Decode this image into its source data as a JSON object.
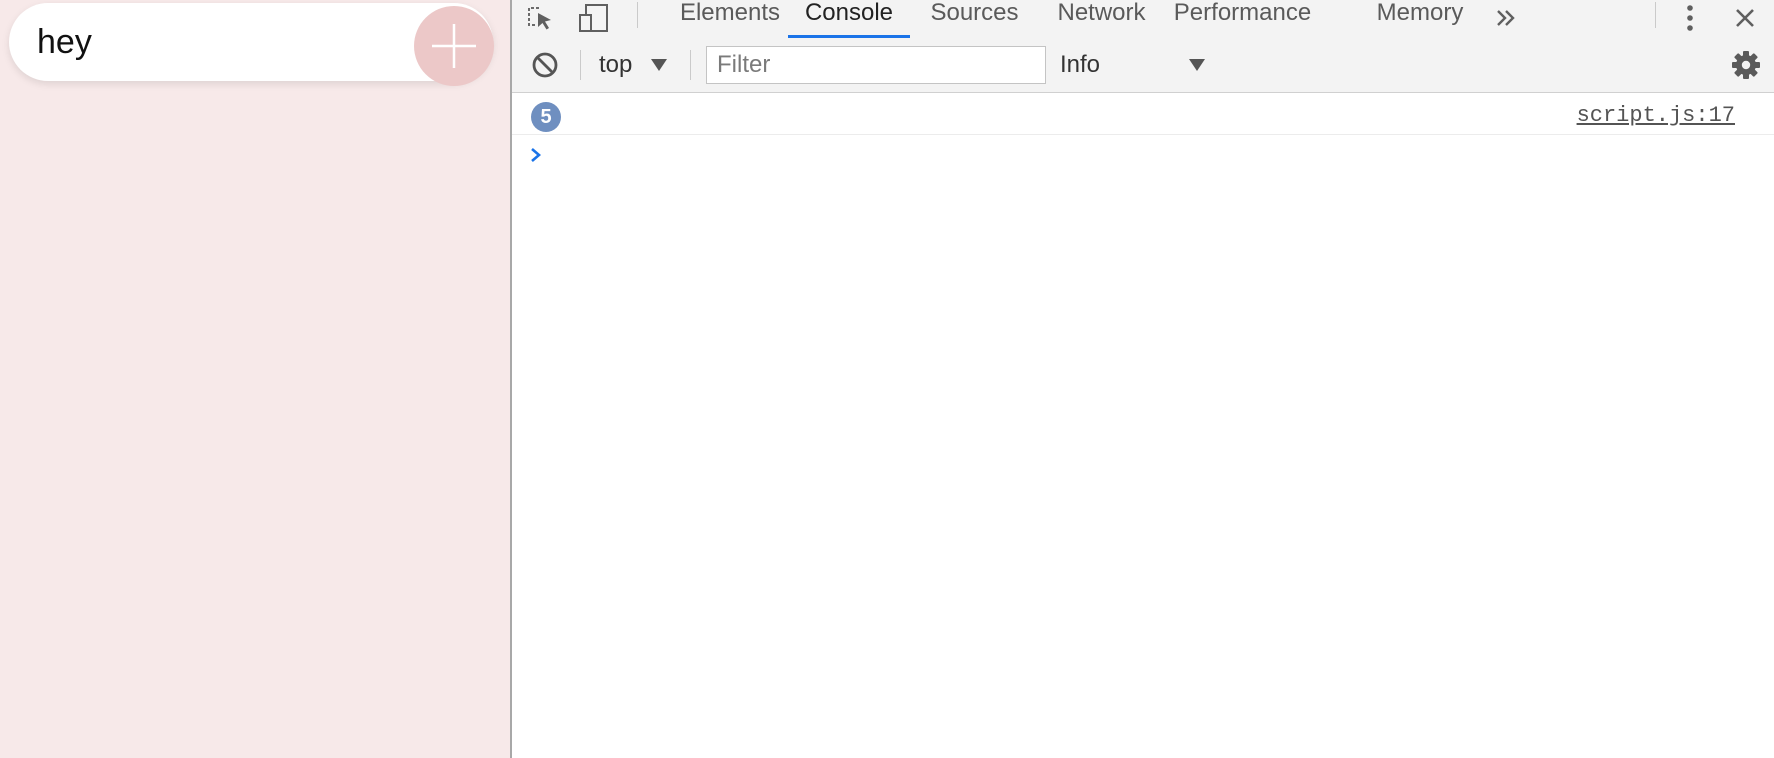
{
  "page": {
    "todo_input_value": "hey",
    "add_button_icon": "plus-icon",
    "background_color": "#f7e9e9",
    "add_button_color": "#ecc8c8"
  },
  "devtools": {
    "toolbar_icons": [
      "inspect-element-icon",
      "device-toolbar-icon",
      "more-tabs-icon",
      "more-options-icon",
      "close-icon"
    ],
    "tabs": [
      {
        "label": "Elements",
        "active": false
      },
      {
        "label": "Console",
        "active": true
      },
      {
        "label": "Sources",
        "active": false
      },
      {
        "label": "Network",
        "active": false
      },
      {
        "label": "Performance",
        "active": false
      },
      {
        "label": "Memory",
        "active": false
      }
    ],
    "console_toolbar": {
      "clear_icon": "clear-console-icon",
      "context": "top",
      "filter_placeholder": "Filter",
      "filter_value": "",
      "level": "Info",
      "settings_icon": "gear-icon"
    },
    "messages": [
      {
        "repeat_count": "5",
        "text": "",
        "source": "script.js:17"
      }
    ],
    "prompt_icon": "chevron-right-icon",
    "accent_color": "#1a73e8",
    "badge_color": "#6f8fc0"
  }
}
